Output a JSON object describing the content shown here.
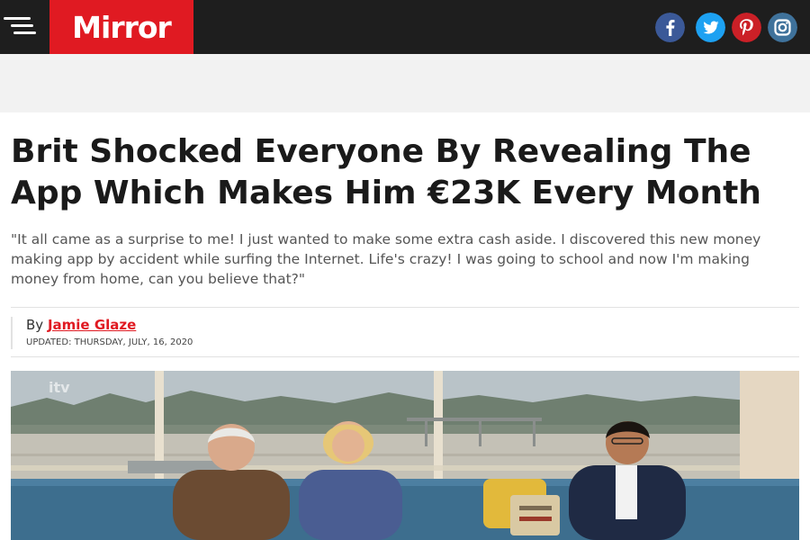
{
  "header": {
    "logo_text": "Mirror",
    "brand_color": "#e01a22",
    "bar_color": "#1e1e1e",
    "menu_icon": "hamburger-menu-icon",
    "social_links": [
      {
        "name": "facebook",
        "icon": "facebook-icon",
        "color": "#3b5998"
      },
      {
        "name": "twitter",
        "icon": "twitter-icon",
        "color": "#1da1f2"
      },
      {
        "name": "pinterest",
        "icon": "pinterest-icon",
        "color": "#cb2027"
      },
      {
        "name": "instagram",
        "icon": "instagram-icon",
        "color": "#3f729b"
      }
    ]
  },
  "article": {
    "headline": "Brit Shocked Everyone By Revealing The App Which Makes Him €23K Every Month",
    "standfirst": "\"It all came as a surprise to me! I just wanted to make some extra cash aside. I discovered this new money making app by accident while surfing the Internet. Life's crazy! I was going to school and now I'm making money from home, can you believe that?\"",
    "byline_prefix": "By",
    "author": "Jamie Glaze",
    "updated": "UPDATED: THURSDAY, JULY, 16, 2020",
    "image_watermark": "itv"
  }
}
